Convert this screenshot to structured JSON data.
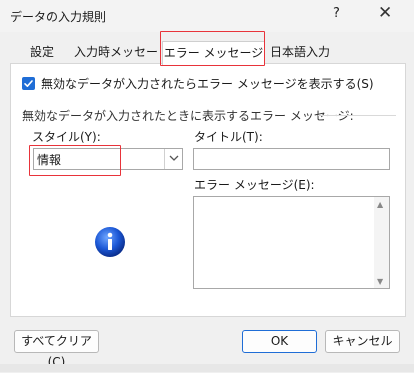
{
  "window": {
    "title": "データの入力規則",
    "help_label": "?",
    "close_label": "✕"
  },
  "tabs": [
    {
      "label": "設定",
      "active": false
    },
    {
      "label": "入力時メッセージ",
      "active": false
    },
    {
      "label": "エラー メッセージ",
      "active": true
    },
    {
      "label": "日本語入力",
      "active": false
    }
  ],
  "error_alert": {
    "show_checkbox_label": "無効なデータが入力されたらエラー メッセージを表示する(S)",
    "show_checkbox_checked": true,
    "group_title": "無効なデータが入力されたときに表示するエラー メッセージ:",
    "style_label": "スタイル(Y):",
    "style_value": "情報",
    "style_icon": "info-icon",
    "title_label": "タイトル(T):",
    "title_value": "",
    "message_label": "エラー メッセージ(E):",
    "message_value": ""
  },
  "buttons": {
    "clear_all": "すべてクリア(C)",
    "ok": "OK",
    "cancel": "キャンセル"
  },
  "colors": {
    "accent": "#1f6dd6",
    "highlight": "#e8333a"
  }
}
